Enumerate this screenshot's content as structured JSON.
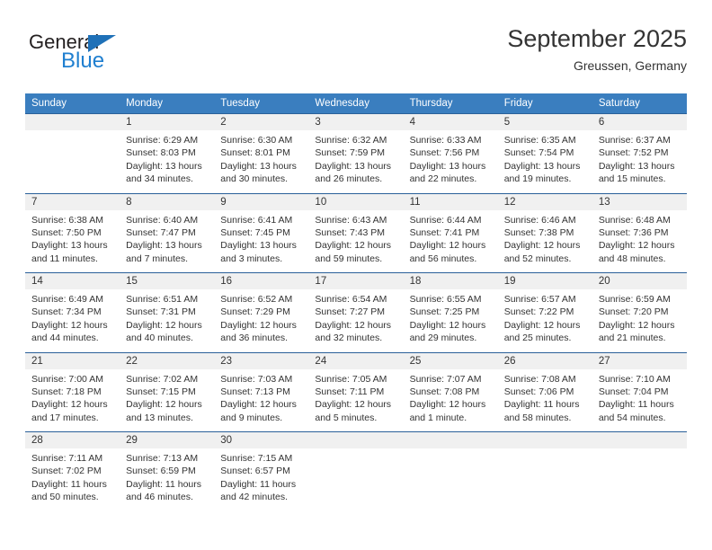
{
  "brand": {
    "name_part1": "General",
    "name_part2": "Blue",
    "triangle_icon": "blue-triangle-icon",
    "accent_color": "#1f7fd0"
  },
  "header": {
    "title": "September 2025",
    "subtitle": "Greussen, Germany"
  },
  "colors": {
    "header_row_bg": "#3a7ebf",
    "row_separator": "#2a6099",
    "daynum_band_bg": "#f0f0f0",
    "text": "#333333"
  },
  "weekdays": [
    "Sunday",
    "Monday",
    "Tuesday",
    "Wednesday",
    "Thursday",
    "Friday",
    "Saturday"
  ],
  "weeks": [
    [
      {
        "day": "",
        "lines": [
          "",
          "",
          "",
          ""
        ]
      },
      {
        "day": "1",
        "lines": [
          "Sunrise: 6:29 AM",
          "Sunset: 8:03 PM",
          "Daylight: 13 hours",
          "and 34 minutes."
        ]
      },
      {
        "day": "2",
        "lines": [
          "Sunrise: 6:30 AM",
          "Sunset: 8:01 PM",
          "Daylight: 13 hours",
          "and 30 minutes."
        ]
      },
      {
        "day": "3",
        "lines": [
          "Sunrise: 6:32 AM",
          "Sunset: 7:59 PM",
          "Daylight: 13 hours",
          "and 26 minutes."
        ]
      },
      {
        "day": "4",
        "lines": [
          "Sunrise: 6:33 AM",
          "Sunset: 7:56 PM",
          "Daylight: 13 hours",
          "and 22 minutes."
        ]
      },
      {
        "day": "5",
        "lines": [
          "Sunrise: 6:35 AM",
          "Sunset: 7:54 PM",
          "Daylight: 13 hours",
          "and 19 minutes."
        ]
      },
      {
        "day": "6",
        "lines": [
          "Sunrise: 6:37 AM",
          "Sunset: 7:52 PM",
          "Daylight: 13 hours",
          "and 15 minutes."
        ]
      }
    ],
    [
      {
        "day": "7",
        "lines": [
          "Sunrise: 6:38 AM",
          "Sunset: 7:50 PM",
          "Daylight: 13 hours",
          "and 11 minutes."
        ]
      },
      {
        "day": "8",
        "lines": [
          "Sunrise: 6:40 AM",
          "Sunset: 7:47 PM",
          "Daylight: 13 hours",
          "and 7 minutes."
        ]
      },
      {
        "day": "9",
        "lines": [
          "Sunrise: 6:41 AM",
          "Sunset: 7:45 PM",
          "Daylight: 13 hours",
          "and 3 minutes."
        ]
      },
      {
        "day": "10",
        "lines": [
          "Sunrise: 6:43 AM",
          "Sunset: 7:43 PM",
          "Daylight: 12 hours",
          "and 59 minutes."
        ]
      },
      {
        "day": "11",
        "lines": [
          "Sunrise: 6:44 AM",
          "Sunset: 7:41 PM",
          "Daylight: 12 hours",
          "and 56 minutes."
        ]
      },
      {
        "day": "12",
        "lines": [
          "Sunrise: 6:46 AM",
          "Sunset: 7:38 PM",
          "Daylight: 12 hours",
          "and 52 minutes."
        ]
      },
      {
        "day": "13",
        "lines": [
          "Sunrise: 6:48 AM",
          "Sunset: 7:36 PM",
          "Daylight: 12 hours",
          "and 48 minutes."
        ]
      }
    ],
    [
      {
        "day": "14",
        "lines": [
          "Sunrise: 6:49 AM",
          "Sunset: 7:34 PM",
          "Daylight: 12 hours",
          "and 44 minutes."
        ]
      },
      {
        "day": "15",
        "lines": [
          "Sunrise: 6:51 AM",
          "Sunset: 7:31 PM",
          "Daylight: 12 hours",
          "and 40 minutes."
        ]
      },
      {
        "day": "16",
        "lines": [
          "Sunrise: 6:52 AM",
          "Sunset: 7:29 PM",
          "Daylight: 12 hours",
          "and 36 minutes."
        ]
      },
      {
        "day": "17",
        "lines": [
          "Sunrise: 6:54 AM",
          "Sunset: 7:27 PM",
          "Daylight: 12 hours",
          "and 32 minutes."
        ]
      },
      {
        "day": "18",
        "lines": [
          "Sunrise: 6:55 AM",
          "Sunset: 7:25 PM",
          "Daylight: 12 hours",
          "and 29 minutes."
        ]
      },
      {
        "day": "19",
        "lines": [
          "Sunrise: 6:57 AM",
          "Sunset: 7:22 PM",
          "Daylight: 12 hours",
          "and 25 minutes."
        ]
      },
      {
        "day": "20",
        "lines": [
          "Sunrise: 6:59 AM",
          "Sunset: 7:20 PM",
          "Daylight: 12 hours",
          "and 21 minutes."
        ]
      }
    ],
    [
      {
        "day": "21",
        "lines": [
          "Sunrise: 7:00 AM",
          "Sunset: 7:18 PM",
          "Daylight: 12 hours",
          "and 17 minutes."
        ]
      },
      {
        "day": "22",
        "lines": [
          "Sunrise: 7:02 AM",
          "Sunset: 7:15 PM",
          "Daylight: 12 hours",
          "and 13 minutes."
        ]
      },
      {
        "day": "23",
        "lines": [
          "Sunrise: 7:03 AM",
          "Sunset: 7:13 PM",
          "Daylight: 12 hours",
          "and 9 minutes."
        ]
      },
      {
        "day": "24",
        "lines": [
          "Sunrise: 7:05 AM",
          "Sunset: 7:11 PM",
          "Daylight: 12 hours",
          "and 5 minutes."
        ]
      },
      {
        "day": "25",
        "lines": [
          "Sunrise: 7:07 AM",
          "Sunset: 7:08 PM",
          "Daylight: 12 hours",
          "and 1 minute."
        ]
      },
      {
        "day": "26",
        "lines": [
          "Sunrise: 7:08 AM",
          "Sunset: 7:06 PM",
          "Daylight: 11 hours",
          "and 58 minutes."
        ]
      },
      {
        "day": "27",
        "lines": [
          "Sunrise: 7:10 AM",
          "Sunset: 7:04 PM",
          "Daylight: 11 hours",
          "and 54 minutes."
        ]
      }
    ],
    [
      {
        "day": "28",
        "lines": [
          "Sunrise: 7:11 AM",
          "Sunset: 7:02 PM",
          "Daylight: 11 hours",
          "and 50 minutes."
        ]
      },
      {
        "day": "29",
        "lines": [
          "Sunrise: 7:13 AM",
          "Sunset: 6:59 PM",
          "Daylight: 11 hours",
          "and 46 minutes."
        ]
      },
      {
        "day": "30",
        "lines": [
          "Sunrise: 7:15 AM",
          "Sunset: 6:57 PM",
          "Daylight: 11 hours",
          "and 42 minutes."
        ]
      },
      {
        "day": "",
        "lines": [
          "",
          "",
          "",
          ""
        ]
      },
      {
        "day": "",
        "lines": [
          "",
          "",
          "",
          ""
        ]
      },
      {
        "day": "",
        "lines": [
          "",
          "",
          "",
          ""
        ]
      },
      {
        "day": "",
        "lines": [
          "",
          "",
          "",
          ""
        ]
      }
    ]
  ]
}
